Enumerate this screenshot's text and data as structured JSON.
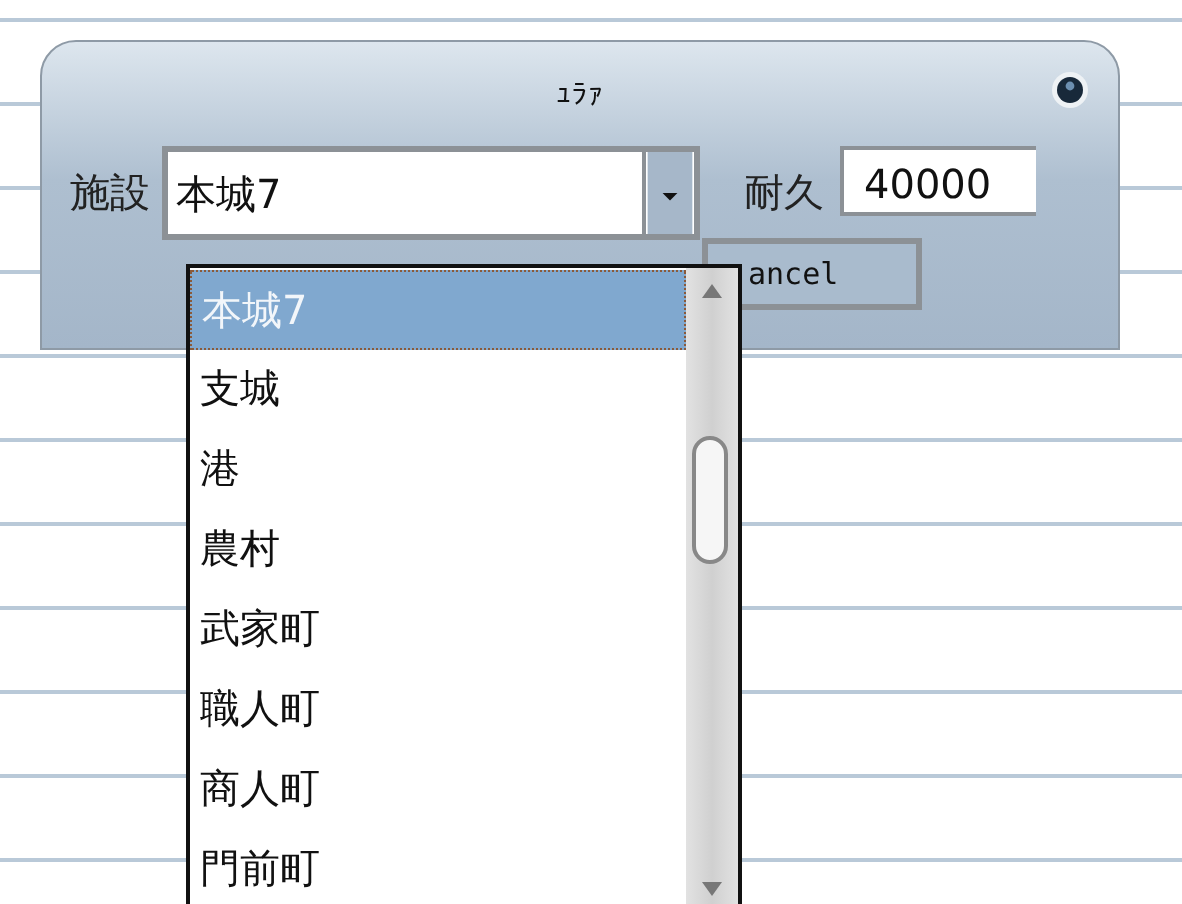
{
  "dialog": {
    "title": "ｭﾗｧ"
  },
  "facility": {
    "label": "施設",
    "value": "本城7"
  },
  "durability": {
    "label": "耐久",
    "value": "40000"
  },
  "cancel_button": {
    "label": "ancel"
  },
  "dropdown": {
    "items": [
      {
        "label": "本城7",
        "selected": true
      },
      {
        "label": "支城",
        "selected": false
      },
      {
        "label": "港",
        "selected": false
      },
      {
        "label": "農村",
        "selected": false
      },
      {
        "label": "武家町",
        "selected": false
      },
      {
        "label": "職人町",
        "selected": false
      },
      {
        "label": "商人町",
        "selected": false
      },
      {
        "label": "門前町",
        "selected": false
      }
    ]
  }
}
